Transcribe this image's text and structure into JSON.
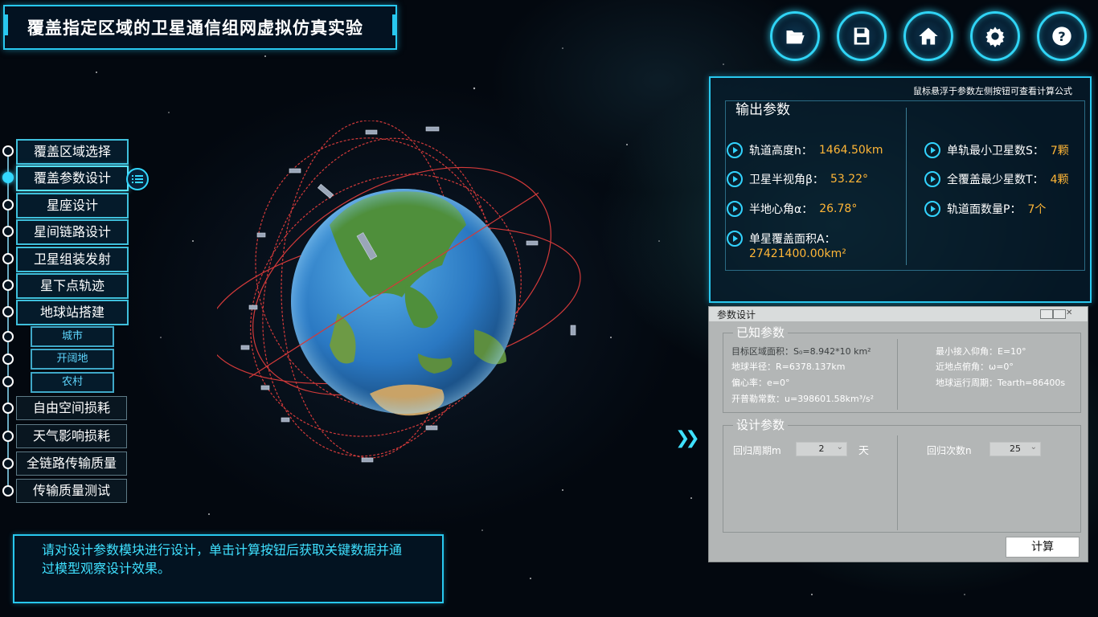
{
  "app": {
    "title": "覆盖指定区域的卫星通信组网虚拟仿真实验"
  },
  "toolbar": {
    "icons": [
      "folder-open-icon",
      "save-icon",
      "home-icon",
      "gear-icon",
      "help-icon"
    ]
  },
  "nav": {
    "items": [
      {
        "label": "覆盖区域选择"
      },
      {
        "label": "覆盖参数设计"
      },
      {
        "label": "星座设计"
      },
      {
        "label": "星间链路设计"
      },
      {
        "label": "卫星组装发射"
      },
      {
        "label": "星下点轨迹"
      },
      {
        "label": "地球站搭建"
      },
      {
        "label": "城市"
      },
      {
        "label": "开阔地"
      },
      {
        "label": "农村"
      },
      {
        "label": "自由空间损耗"
      },
      {
        "label": "天气影响损耗"
      },
      {
        "label": "全链路传输质量"
      },
      {
        "label": "传输质量测试"
      }
    ]
  },
  "message": {
    "text": "请对设计参数模块进行设计，单击计算按钮后获取关键数据并通过模型观察设计效果。"
  },
  "output": {
    "hint": "鼠标悬浮于参数左侧按钮可查看计算公式",
    "heading": "输出参数",
    "left": [
      {
        "label": "轨道高度h：",
        "value": "1464.50km"
      },
      {
        "label": "卫星半视角β：",
        "value": "53.22°"
      },
      {
        "label": "半地心角α：",
        "value": "26.78°"
      },
      {
        "label": "单星覆盖面积A：",
        "value": "27421400.00km²"
      }
    ],
    "right": [
      {
        "label": "单轨最小卫星数S：",
        "value": "7颗"
      },
      {
        "label": "全覆盖最少星数T：",
        "value": "4颗"
      },
      {
        "label": "轨道面数量P：",
        "value": "7个"
      }
    ]
  },
  "dialog": {
    "title": "参数设计",
    "known_heading": "已知参数",
    "known_left": [
      "目标区域面积：S₀=8.942*10  km²",
      "地球半径：R=6378.137km",
      "偏心率：e=0°",
      "开普勒常数：u=398601.58km³/s²"
    ],
    "known_right": [
      "最小接入仰角：E=10°",
      "近地点俯角：ω=0°",
      "地球运行周期：Tearth=86400s"
    ],
    "design_heading": "设计参数",
    "period_label": "回归周期m",
    "period_value": "2",
    "period_unit": "天",
    "count_label": "回归次数n",
    "count_value": "25",
    "calc_label": "计算"
  }
}
